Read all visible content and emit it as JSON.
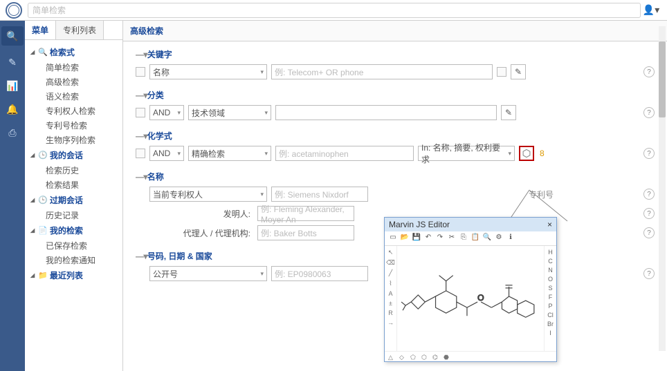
{
  "header": {
    "search_placeholder": "简单检索",
    "user_icon": "user"
  },
  "sidebar": {
    "tabs": [
      "菜单",
      "专利列表"
    ],
    "groups": [
      {
        "icon": "🔍",
        "label": "检索式",
        "items": [
          "简单检索",
          "高级检索",
          "语义检索",
          "专利权人检索",
          "专利号检索",
          "生物序列检索"
        ]
      },
      {
        "icon": "🕒",
        "label": "我的会话",
        "items": [
          "检索历史",
          "检索结果"
        ]
      },
      {
        "icon": "🕒",
        "label": "过期会话",
        "items": [
          "历史记录"
        ]
      },
      {
        "icon": "📄",
        "label": "我的检索",
        "items": [
          "已保存检索",
          "我的检索通知"
        ]
      },
      {
        "icon": "📁",
        "label": "最近列表",
        "items": []
      }
    ]
  },
  "main": {
    "title": "高级检索",
    "sections": {
      "keyword": {
        "title": "关键字",
        "field": "名称",
        "placeholder": "例: Telecom+ OR phone"
      },
      "classify": {
        "title": "分类",
        "op": "AND",
        "field": "技术领域"
      },
      "chemical": {
        "title": "化学式",
        "op": "AND",
        "mode": "精确检索",
        "placeholder": "例: acetaminophen",
        "in_label": "In: 名称, 摘要, 权利要求",
        "annotation": "8"
      },
      "names": {
        "title": "名称",
        "field": "当前专利权人",
        "placeholder": "例: Siemens Nixdorf",
        "inventor_label": "发明人:",
        "inventor_ph": "例: Fleming Alexander, Moyer An",
        "agent_label": "代理人 / 代理机构:",
        "agent_ph": "例: Baker Botts"
      },
      "codes": {
        "title": "号码, 日期 & 国家",
        "field": "公开号",
        "placeholder": "例: EP0980063",
        "suffix": "专利号"
      }
    }
  },
  "editor": {
    "title": "Marvin JS Editor",
    "right_atoms": [
      "H",
      "C",
      "N",
      "O",
      "S",
      "F",
      "P",
      "Cl",
      "Br",
      "I"
    ]
  }
}
